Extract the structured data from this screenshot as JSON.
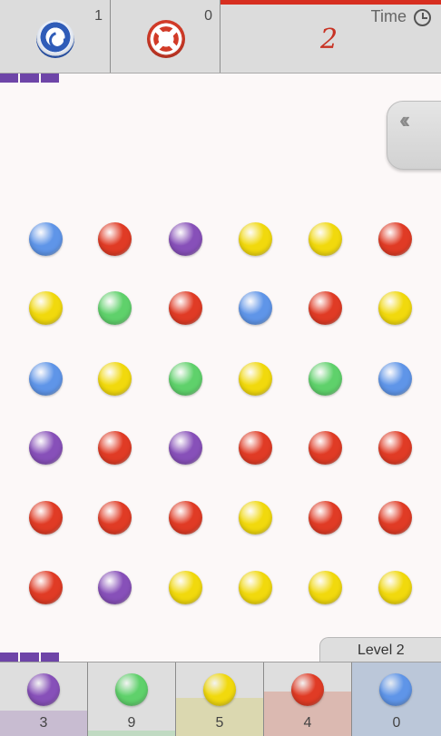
{
  "powerups": [
    {
      "name": "shuffle",
      "count": "1",
      "icon": "shuffle-icon"
    },
    {
      "name": "bomb",
      "count": "0",
      "icon": "bomb-icon"
    }
  ],
  "timer": {
    "label": "Time",
    "value": "2",
    "progress": 1.0,
    "icon": "clock-icon"
  },
  "side_button": {
    "icon": "double-chevron-left-icon"
  },
  "colors": {
    "blue": "#5f95e8",
    "red": "#e03b25",
    "purple": "#8750b9",
    "yellow": "#f1d90d",
    "green": "#5fd16b",
    "accent": "#6e45a8"
  },
  "board": [
    [
      "blue",
      "red",
      "purple",
      "yellow",
      "yellow",
      "red"
    ],
    [
      "yellow",
      "green",
      "red",
      "blue",
      "red",
      "yellow"
    ],
    [
      "blue",
      "yellow",
      "green",
      "yellow",
      "green",
      "blue"
    ],
    [
      "purple",
      "red",
      "purple",
      "red",
      "red",
      "red"
    ],
    [
      "red",
      "red",
      "red",
      "yellow",
      "red",
      "red"
    ],
    [
      "red",
      "purple",
      "yellow",
      "yellow",
      "yellow",
      "yellow"
    ]
  ],
  "level": {
    "label": "Level 2"
  },
  "goals": [
    {
      "color": "purple",
      "count": "3",
      "fill": 0.35,
      "fill_color": "#b7a0c6"
    },
    {
      "color": "green",
      "count": "9",
      "fill": 0.08,
      "fill_color": "#a8d7ac"
    },
    {
      "color": "yellow",
      "count": "5",
      "fill": 0.52,
      "fill_color": "#d8d48a"
    },
    {
      "color": "red",
      "count": "4",
      "fill": 0.6,
      "fill_color": "#d99b8d"
    },
    {
      "color": "blue",
      "count": "0",
      "fill": 1.0,
      "fill_color": "#9fb5d6"
    }
  ]
}
